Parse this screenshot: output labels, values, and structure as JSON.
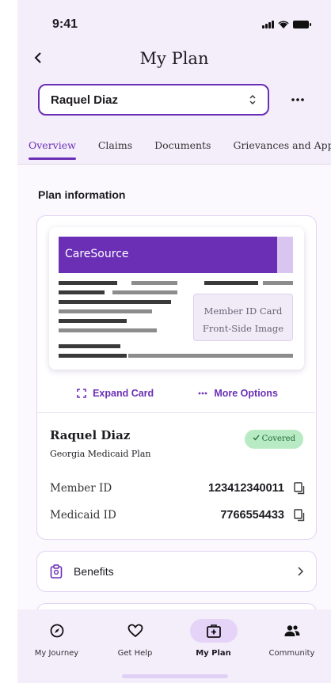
{
  "status_bar": {
    "time": "9:41"
  },
  "header": {
    "title": "My Plan",
    "member_select": {
      "value": "Raquel Diaz"
    }
  },
  "tabs": [
    {
      "label": "Overview",
      "active": true
    },
    {
      "label": "Claims",
      "active": false
    },
    {
      "label": "Documents",
      "active": false
    },
    {
      "label": "Grievances and Appeals",
      "active": false
    }
  ],
  "plan_information": {
    "section_title": "Plan information",
    "card": {
      "brand": "CareSource",
      "placeholder_line1": "Member ID Card",
      "placeholder_line2": "Front-Side Image"
    },
    "actions": {
      "expand_label": "Expand Card",
      "more_label": "More Options"
    },
    "member_name": "Raquel Diaz",
    "plan_name": "Georgia Medicaid Plan",
    "status_badge": "Covered",
    "member_id": {
      "label": "Member ID",
      "value": "123412340011"
    },
    "medicaid_id": {
      "label": "Medicaid ID",
      "value": "7766554433"
    }
  },
  "benefits": {
    "label": "Benefits"
  },
  "bottom_nav": [
    {
      "label": "My Journey",
      "icon": "compass-icon",
      "active": false
    },
    {
      "label": "Get Help",
      "icon": "heart-icon",
      "active": false
    },
    {
      "label": "My Plan",
      "icon": "medical-kit-icon",
      "active": true
    },
    {
      "label": "Community",
      "icon": "people-icon",
      "active": false
    }
  ],
  "colors": {
    "brand_purple": "#6b2fb6",
    "header_bg": "#f4eefb",
    "covered_bg": "#b8ebc4",
    "covered_text": "#1e6b34"
  }
}
